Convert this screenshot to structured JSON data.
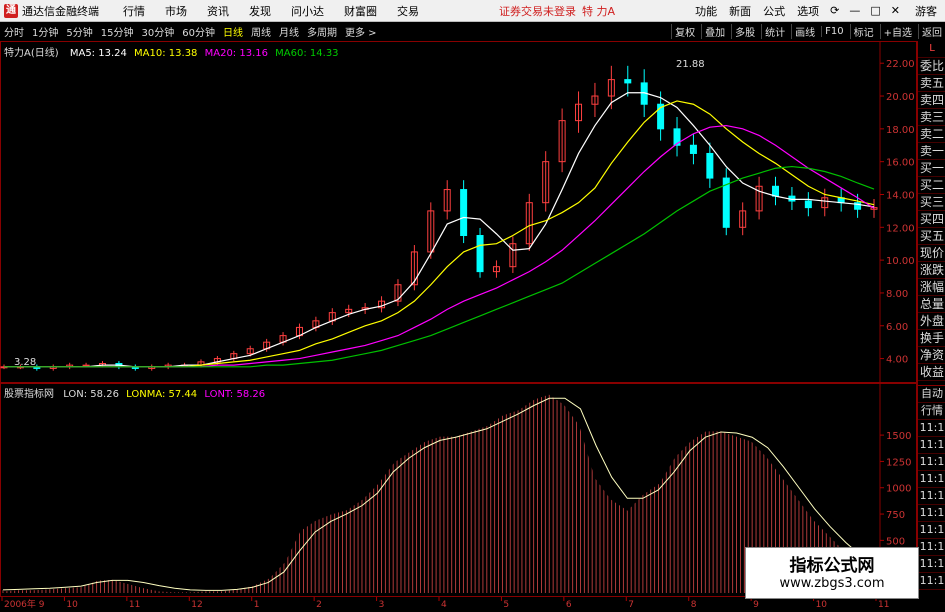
{
  "app": {
    "title": "通达信金融终端",
    "menus": [
      "行情",
      "市场",
      "资讯",
      "发现",
      "问小达",
      "财富圈",
      "交易"
    ],
    "notice": "证券交易未登录",
    "stock_title": "特 力A",
    "right_menus": [
      "功能",
      "新面",
      "公式",
      "选项"
    ],
    "guest": "游客"
  },
  "toolbar": {
    "timeframes": [
      "分时",
      "1分钟",
      "5分钟",
      "15分钟",
      "30分钟",
      "60分钟",
      "日线",
      "周线",
      "月线",
      "多周期",
      "更多 >"
    ],
    "active_timeframe": "日线",
    "right_buttons": [
      "复权",
      "叠加",
      "多股",
      "统计",
      "画线",
      "F10",
      "标记",
      "+自选",
      "返回"
    ]
  },
  "main_legend": {
    "stock": "特力A(日线)",
    "ma5": "MA5: 13.24",
    "ma10": "MA10: 13.38",
    "ma20": "MA20: 13.16",
    "ma60": "MA60: 14.33",
    "high_label": "21.88",
    "low_label": "3.28"
  },
  "lower_legend": {
    "name": "股票指标网",
    "lon": "LON: 58.26",
    "lonma": "LONMA: 57.44",
    "lont": "LONT: 58.26"
  },
  "side_panel": {
    "top_marker": "L",
    "items": [
      "委比",
      "卖五",
      "卖四",
      "卖三",
      "卖二",
      "卖一",
      "买一",
      "买二",
      "买三",
      "买四",
      "买五",
      "现价",
      "涨跌",
      "涨幅",
      "总量",
      "外盘",
      "换手",
      "净资",
      "收益"
    ],
    "lower_items": [
      "自动",
      "行情",
      "11:1",
      "11:1",
      "11:1",
      "11:1",
      "11:1",
      "11:1",
      "11:1",
      "11:1",
      "11:1",
      "11:1"
    ]
  },
  "watermark": {
    "line1": "指标公式网",
    "line2": "www.zbgs3.com"
  },
  "colors": {
    "ma5": "#ffffff",
    "ma10": "#ffff00",
    "ma20": "#ff00ff",
    "ma60": "#00c000",
    "bars": "#c04040",
    "lonma": "#ffffc0",
    "up": "#ff4040",
    "down": "#00ffff"
  },
  "chart_data": [
    {
      "type": "candlestick",
      "title": "特力A(日线)",
      "ylim": [
        3.0,
        22.5
      ],
      "y_ticks": [
        4.0,
        6.0,
        8.0,
        10.0,
        12.0,
        14.0,
        16.0,
        18.0,
        20.0,
        22.0
      ],
      "series": [
        {
          "name": "close",
          "values": [
            3.5,
            3.5,
            3.4,
            3.5,
            3.6,
            3.6,
            3.7,
            3.5,
            3.4,
            3.5,
            3.6,
            3.6,
            3.8,
            4.0,
            4.3,
            4.6,
            5.0,
            5.4,
            5.9,
            6.3,
            6.8,
            7.0,
            7.1,
            7.5,
            8.5,
            10.5,
            13.0,
            14.3,
            11.5,
            9.3,
            9.6,
            11.0,
            13.5,
            16.0,
            18.5,
            19.5,
            20.0,
            21.0,
            20.8,
            19.5,
            18.0,
            17.0,
            16.5,
            15.0,
            12.0,
            13.0,
            14.5,
            13.9,
            13.6,
            13.2,
            13.8,
            13.5,
            13.1,
            13.2
          ]
        },
        {
          "name": "MA5",
          "values": [
            3.5,
            3.5,
            3.5,
            3.5,
            3.5,
            3.5,
            3.6,
            3.6,
            3.5,
            3.5,
            3.5,
            3.6,
            3.6,
            3.8,
            4.0,
            4.2,
            4.6,
            5.0,
            5.4,
            5.9,
            6.3,
            6.7,
            7.0,
            7.2,
            7.6,
            8.7,
            10.4,
            12.2,
            12.6,
            12.5,
            11.6,
            10.6,
            10.7,
            12.2,
            14.3,
            16.5,
            18.2,
            19.6,
            20.2,
            20.2,
            19.9,
            19.3,
            18.2,
            17.0,
            15.7,
            14.7,
            14.2,
            13.9,
            13.7,
            13.7,
            13.6,
            13.5,
            13.4,
            13.24
          ]
        },
        {
          "name": "MA10",
          "values": [
            3.5,
            3.5,
            3.5,
            3.5,
            3.5,
            3.5,
            3.5,
            3.5,
            3.5,
            3.5,
            3.5,
            3.5,
            3.6,
            3.7,
            3.8,
            3.9,
            4.1,
            4.3,
            4.5,
            4.9,
            5.2,
            5.6,
            6.0,
            6.3,
            6.8,
            7.5,
            8.5,
            9.6,
            10.5,
            10.9,
            11.0,
            11.5,
            12.1,
            12.4,
            12.9,
            13.5,
            14.4,
            15.9,
            17.2,
            18.4,
            19.3,
            19.7,
            19.5,
            18.9,
            18.0,
            17.2,
            16.5,
            15.9,
            15.2,
            14.5,
            14.0,
            13.8,
            13.6,
            13.38
          ]
        },
        {
          "name": "MA20",
          "values": [
            3.5,
            3.5,
            3.5,
            3.5,
            3.5,
            3.5,
            3.5,
            3.5,
            3.5,
            3.5,
            3.5,
            3.5,
            3.5,
            3.6,
            3.6,
            3.7,
            3.8,
            3.9,
            4.0,
            4.2,
            4.4,
            4.6,
            4.8,
            5.1,
            5.4,
            5.9,
            6.4,
            7.0,
            7.5,
            7.9,
            8.3,
            8.8,
            9.3,
            9.9,
            10.6,
            11.5,
            12.4,
            13.4,
            14.4,
            15.4,
            16.3,
            17.1,
            17.7,
            18.1,
            18.2,
            18.0,
            17.6,
            17.0,
            16.3,
            15.6,
            15.0,
            14.4,
            13.8,
            13.16
          ]
        },
        {
          "name": "MA60",
          "values": [
            3.5,
            3.5,
            3.5,
            3.5,
            3.5,
            3.5,
            3.5,
            3.5,
            3.5,
            3.5,
            3.5,
            3.5,
            3.5,
            3.5,
            3.5,
            3.5,
            3.6,
            3.6,
            3.7,
            3.8,
            3.9,
            4.1,
            4.3,
            4.5,
            4.8,
            5.1,
            5.4,
            5.8,
            6.2,
            6.6,
            7.0,
            7.4,
            7.8,
            8.2,
            8.6,
            9.2,
            9.8,
            10.4,
            11.0,
            11.6,
            12.3,
            13.0,
            13.6,
            14.2,
            14.6,
            15.0,
            15.3,
            15.6,
            15.7,
            15.6,
            15.4,
            15.1,
            14.7,
            14.33
          ]
        }
      ]
    },
    {
      "type": "bar",
      "title": "股票指标网",
      "ylim": [
        0,
        1900
      ],
      "y_ticks": [
        500,
        750,
        1000,
        1250,
        1500
      ],
      "series": [
        {
          "name": "LON",
          "values": [
            30,
            40,
            40,
            50,
            60,
            70,
            130,
            140,
            100,
            60,
            30,
            20,
            20,
            30,
            30,
            50,
            80,
            150,
            300,
            600,
            700,
            760,
            800,
            900,
            1050,
            1250,
            1350,
            1450,
            1500,
            1500,
            1550,
            1600,
            1700,
            1750,
            1850,
            1900,
            1800,
            1600,
            1100,
            900,
            800,
            950,
            1050,
            1300,
            1450,
            1550,
            1550,
            1500,
            1450,
            1300,
            1100,
            900,
            700,
            550,
            400,
            300
          ]
        },
        {
          "name": "LONMA",
          "values": [
            30,
            35,
            40,
            45,
            55,
            65,
            100,
            120,
            120,
            100,
            70,
            45,
            30,
            25,
            25,
            35,
            55,
            100,
            200,
            400,
            580,
            680,
            750,
            830,
            950,
            1150,
            1280,
            1380,
            1450,
            1480,
            1520,
            1560,
            1630,
            1700,
            1780,
            1850,
            1850,
            1750,
            1400,
            1100,
            900,
            900,
            980,
            1150,
            1350,
            1480,
            1530,
            1520,
            1480,
            1380,
            1200,
            1000,
            800,
            630,
            480,
            350
          ]
        }
      ]
    }
  ],
  "x_axis": {
    "labels": [
      "2006年 9",
      "10",
      "11",
      "12",
      "1",
      "2",
      "3",
      "4",
      "5",
      "6",
      "7",
      "8",
      "9",
      "10",
      "11"
    ]
  }
}
